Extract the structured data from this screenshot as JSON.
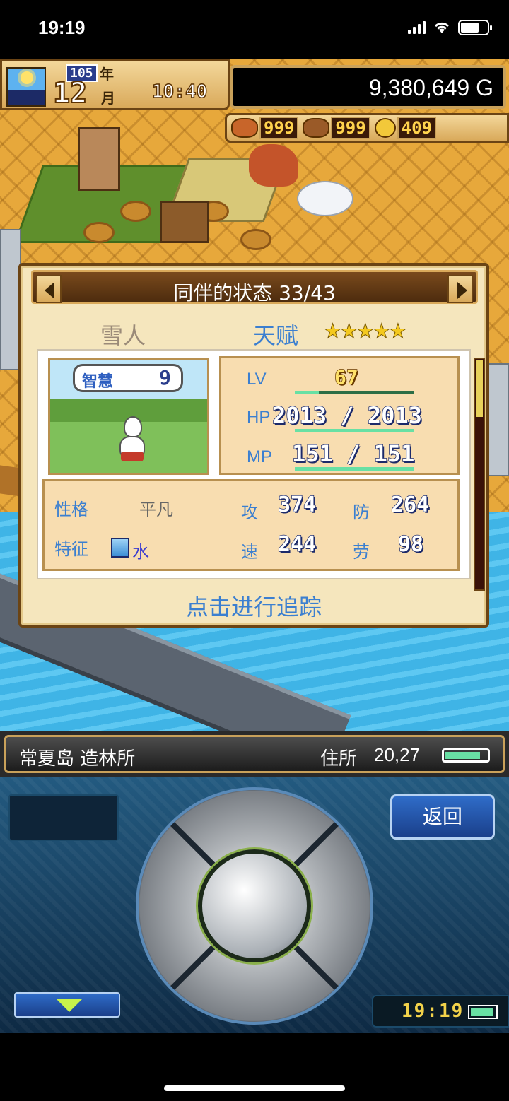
{
  "status_bar": {
    "time": "19:19"
  },
  "hud": {
    "year_number": "105",
    "year_label": "年",
    "month_number": "12",
    "month_label": "月",
    "clock": "10:40",
    "money": "9,380,649 G",
    "resources": [
      {
        "icon": "meat-icon",
        "value": "999"
      },
      {
        "icon": "wood-icon",
        "value": "999"
      },
      {
        "icon": "gold-coin-icon",
        "value": "409"
      }
    ]
  },
  "dialog": {
    "title": "同伴的状态 33/43",
    "monster_name": "雪人",
    "talent_label": "天赋",
    "stars": "★★★★★",
    "bubble": {
      "label": "智慧",
      "value": "9"
    },
    "stats": {
      "lv_label": "LV",
      "lv_value": "67",
      "hp_label": "HP",
      "hp_value": "2013 / 2013",
      "hp_fraction": 1.0,
      "mp_label": "MP",
      "mp_value": "151 / 151",
      "mp_fraction": 1.0,
      "lv_progress": 0.2
    },
    "attributes": {
      "personality_label": "性格",
      "personality_value": "平凡",
      "trait_label": "特征",
      "trait_value": "水",
      "attack_label": "攻",
      "attack_value": "374",
      "defense_label": "防",
      "defense_value": "264",
      "speed_label": "速",
      "speed_value": "244",
      "labor_label": "劳",
      "labor_value": "98"
    },
    "track_button": "点击进行追踪"
  },
  "location": {
    "name": "常夏岛 造林所",
    "address_label": "住所",
    "address_value": "20,27",
    "battery_fraction": 0.85
  },
  "controller": {
    "back_label": "返回",
    "clock": "19:19"
  },
  "colors": {
    "accent_blue": "#3b7fd0",
    "panel_tan": "#f5e6bd",
    "frame_brown": "#6b4414",
    "bar_green": "#68e0a4"
  }
}
